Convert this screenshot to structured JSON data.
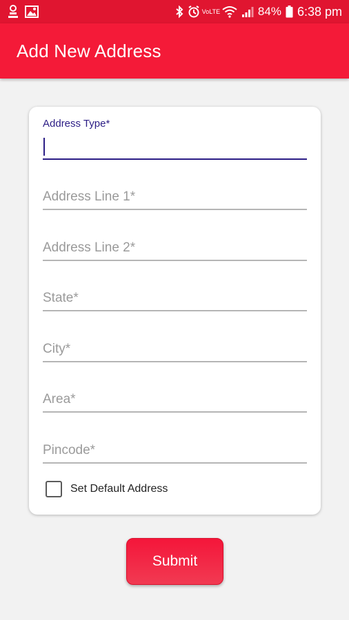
{
  "status_bar": {
    "battery_percent": "84%",
    "time": "6:38 pm",
    "icons": [
      "notification-icon",
      "image-icon",
      "bluetooth-icon",
      "alarm-icon",
      "volte-icon",
      "wifi-icon",
      "signal-icon",
      "battery-icon"
    ],
    "volte_label": "VoLTE"
  },
  "app_bar": {
    "title": "Add New Address"
  },
  "form": {
    "address_type": {
      "label": "Address Type*",
      "value": ""
    },
    "address_line_1": {
      "placeholder": "Address Line 1*"
    },
    "address_line_2": {
      "placeholder": "Address Line 2*"
    },
    "state": {
      "placeholder": "State*"
    },
    "city": {
      "placeholder": "City*"
    },
    "area": {
      "placeholder": "Area*"
    },
    "pincode": {
      "placeholder": "Pincode*"
    },
    "default_checkbox": {
      "label": "Set Default Address",
      "checked": false
    }
  },
  "submit": {
    "label": "Submit"
  },
  "colors": {
    "status_bar": "#e01530",
    "app_bar": "#f41a38",
    "focus": "#2b1c85",
    "background": "#f2f2f2"
  }
}
